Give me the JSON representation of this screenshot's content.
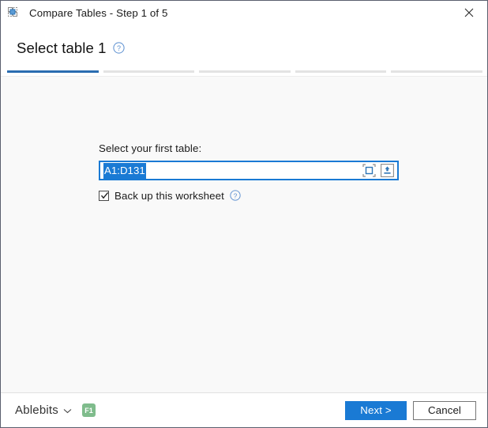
{
  "window": {
    "title": "Compare Tables - Step 1 of 5",
    "icon": "compare-tables-icon",
    "close_label": "✕"
  },
  "header": {
    "title": "Select table 1",
    "help_icon": "help-circle-icon"
  },
  "steps": {
    "total": 5,
    "current": 1,
    "active_color": "#2a6db0",
    "inactive_color": "#e3e3e3"
  },
  "main": {
    "field_label": "Select your first table:",
    "range_input": {
      "value": "A1:D131",
      "placeholder": "",
      "selected": true,
      "selection_color": "#1a7ad4",
      "border_color": "#1a7ad4",
      "pick_range_icon": "select-range-icon",
      "expand_dialog_icon": "collapse-dialog-icon"
    },
    "backup_checkbox": {
      "label": "Back up this worksheet",
      "checked": true,
      "help_icon": "help-circle-icon"
    }
  },
  "footer": {
    "brand": "Ablebits",
    "brand_caret": "chevron-down-icon",
    "f1_badge": "F1",
    "f1_badge_color": "#7fbc8c",
    "next_label": "Next >",
    "cancel_label": "Cancel",
    "primary_color": "#1a7ad4"
  }
}
